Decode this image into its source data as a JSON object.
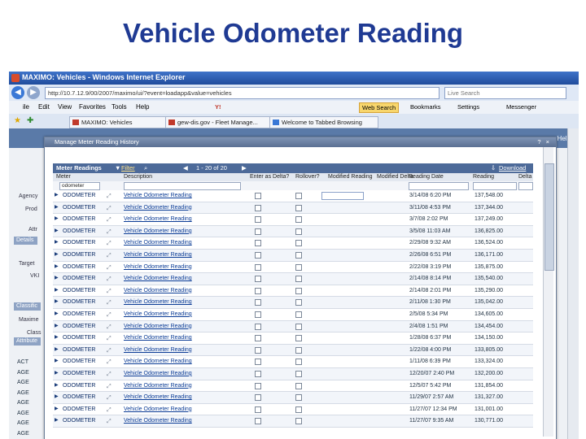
{
  "slide_title": "Vehicle Odometer Reading",
  "browser": {
    "window_title": "MAXIMO: Vehicles - Windows Internet Explorer",
    "address": "http://10.7.12.9/00/2007/maximo/ui/?event=loadapp&value=vehicles",
    "search_placeholder": "Live Search",
    "menu": [
      "ile",
      "Edit",
      "View",
      "Favorites",
      "Tools",
      "Help"
    ],
    "toolbar": {
      "web_search": "Web Search",
      "bookmarks": "Bookmarks",
      "settings": "Settings",
      "messenger": "Messenger"
    },
    "tabs": [
      "MAXIMO: Vehicles",
      "gew-dis.gov - Fleet Manage...",
      "Welcome to Tabbed Browsing"
    ]
  },
  "app": {
    "help": "Help",
    "labels": [
      "Agency",
      "Prod",
      "Attr",
      "Details",
      "Target",
      "VKI",
      "Classific",
      "Maxime",
      "Class",
      "Attribute"
    ],
    "left_rows": [
      "ACT",
      "AGE",
      "AGE",
      "AGE",
      "AGE",
      "AGE",
      "AGE",
      "AGE"
    ]
  },
  "dialog": {
    "title": "Manage Meter Reading History",
    "controls": "? ×",
    "toolbar": {
      "label": "Meter Readings",
      "filter": "Filter",
      "paging": "1 - 20 of 20",
      "download": "Download"
    },
    "columns": [
      "Meter",
      "Description",
      "Enter as Delta?",
      "Rollover?",
      "Modified Reading",
      "Modified Delta",
      "Reading Date",
      "Reading",
      "Delta"
    ],
    "filter_meter": "odometer",
    "rows": [
      {
        "meter": "ODOMETER",
        "description": "Vehicle Odometer Reading",
        "date": "3/14/08 6:20 PM",
        "reading": "137,548.00",
        "selected": true
      },
      {
        "meter": "ODOMETER",
        "description": "Vehicle Odometer Reading",
        "date": "3/11/08 4:53 PM",
        "reading": "137,344.00"
      },
      {
        "meter": "ODOMETER",
        "description": "Vehicle Odometer Reading",
        "date": "3/7/08 2:02 PM",
        "reading": "137,249.00"
      },
      {
        "meter": "ODOMETER",
        "description": "Vehicle Odometer Reading",
        "date": "3/5/08 11:03 AM",
        "reading": "136,825.00"
      },
      {
        "meter": "ODOMETER",
        "description": "Vehicle Odometer Reading",
        "date": "2/29/08 9:32 AM",
        "reading": "136,524.00"
      },
      {
        "meter": "ODOMETER",
        "description": "Vehicle Odometer Reading",
        "date": "2/26/08 6:51 PM",
        "reading": "136,171.00"
      },
      {
        "meter": "ODOMETER",
        "description": "Vehicle Odometer Reading",
        "date": "2/22/08 3:19 PM",
        "reading": "135,875.00"
      },
      {
        "meter": "ODOMETER",
        "description": "Vehicle Odometer Reading",
        "date": "2/14/08 8:14 PM",
        "reading": "135,540.00"
      },
      {
        "meter": "ODOMETER",
        "description": "Vehicle Odometer Reading",
        "date": "2/14/08 2:01 PM",
        "reading": "135,290.00"
      },
      {
        "meter": "ODOMETER",
        "description": "Vehicle Odometer Reading",
        "date": "2/11/08 1:30 PM",
        "reading": "135,042.00"
      },
      {
        "meter": "ODOMETER",
        "description": "Vehicle Odometer Reading",
        "date": "2/5/08 5:34 PM",
        "reading": "134,605.00"
      },
      {
        "meter": "ODOMETER",
        "description": "Vehicle Odometer Reading",
        "date": "2/4/08 1:51 PM",
        "reading": "134,454.00"
      },
      {
        "meter": "ODOMETER",
        "description": "Vehicle Odometer Reading",
        "date": "1/28/08 6:37 PM",
        "reading": "134,150.00"
      },
      {
        "meter": "ODOMETER",
        "description": "Vehicle Odometer Reading",
        "date": "1/22/08 4:00 PM",
        "reading": "133,805.00"
      },
      {
        "meter": "ODOMETER",
        "description": "Vehicle Odometer Reading",
        "date": "1/11/08 6:39 PM",
        "reading": "133,324.00"
      },
      {
        "meter": "ODOMETER",
        "description": "Vehicle Odometer Reading",
        "date": "12/20/07 2:40 PM",
        "reading": "132,200.00"
      },
      {
        "meter": "ODOMETER",
        "description": "Vehicle Odometer Reading",
        "date": "12/5/07 5:42 PM",
        "reading": "131,854.00"
      },
      {
        "meter": "ODOMETER",
        "description": "Vehicle Odometer Reading",
        "date": "11/29/07 2:57 AM",
        "reading": "131,327.00"
      },
      {
        "meter": "ODOMETER",
        "description": "Vehicle Odometer Reading",
        "date": "11/27/07 12:34 PM",
        "reading": "131,001.00"
      },
      {
        "meter": "ODOMETER",
        "description": "Vehicle Odometer Reading",
        "date": "11/27/07 9:35 AM",
        "reading": "130,771.00"
      }
    ]
  }
}
